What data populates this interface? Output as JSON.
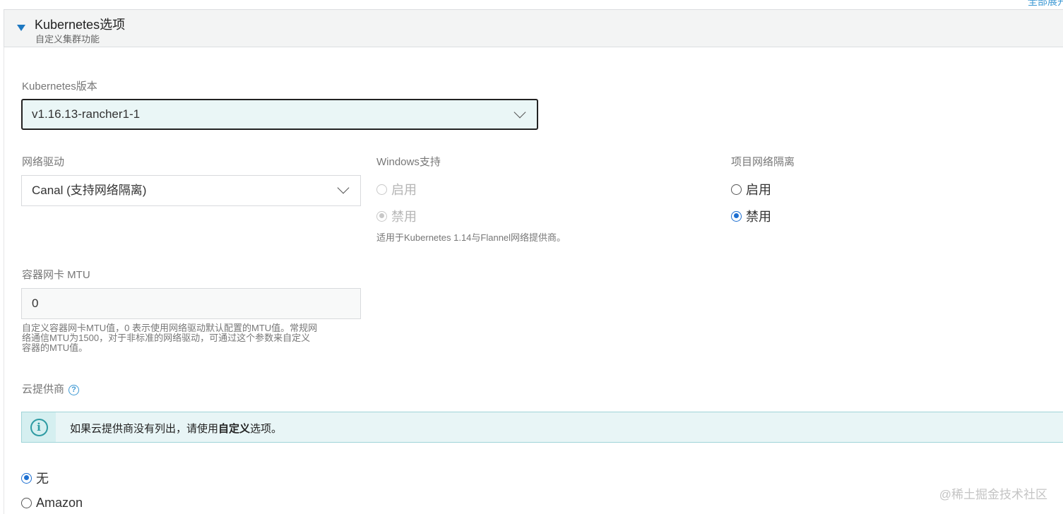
{
  "corner_link": "全部展开",
  "section": {
    "title": "Kubernetes选项",
    "subtitle": "自定义集群功能"
  },
  "k8s_version": {
    "label": "Kubernetes版本",
    "value": "v1.16.13-rancher1-1"
  },
  "network_driver": {
    "label": "网络驱动",
    "value": "Canal (支持网络隔离)"
  },
  "windows_support": {
    "label": "Windows支持",
    "enable": "启用",
    "disable": "禁用",
    "selected": "disable",
    "help": "适用于Kubernetes 1.14与Flannel网络提供商。"
  },
  "project_isolation": {
    "label": "项目网络隔离",
    "enable": "启用",
    "disable": "禁用",
    "selected": "disable"
  },
  "mtu": {
    "label": "容器网卡 MTU",
    "value": "0",
    "help_line1": "自定义容器网卡MTU值，0 表示使用网络驱动默认配置的MTU值。常规网",
    "help_line2": "络通信MTU为1500，对于非标准的网络驱动，可通过这个参数来自定义",
    "help_line3": "容器的MTU值。"
  },
  "cloud_provider": {
    "label": "云提供商",
    "banner_prefix": "如果云提供商没有列出，请使用",
    "banner_bold": "自定义",
    "banner_suffix": "选项。",
    "options": [
      "无",
      "Amazon"
    ],
    "selected": "无"
  },
  "watermark": "@稀土掘金技术社区",
  "colors": {
    "accent": "#1d6fd1",
    "link": "#3d98d3",
    "info": "#2e9ba3"
  }
}
